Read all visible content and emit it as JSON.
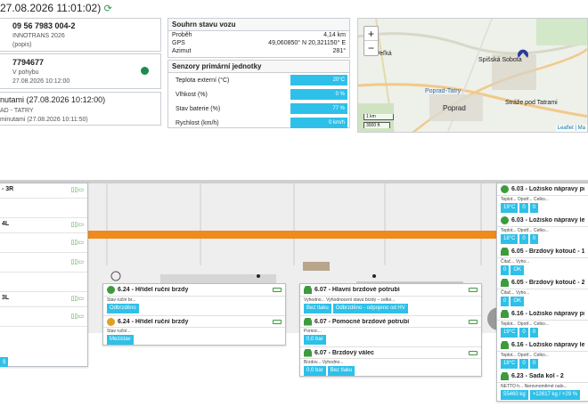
{
  "header": {
    "timestamp": "27.08.2026 11:01:02)"
  },
  "vehicle": {
    "number": "09 56 7983 004-2",
    "owner": "INNOTRANS 2026",
    "description": "(popis)"
  },
  "unit": {
    "id": "7794677",
    "state": "V pohybu",
    "time": "27.08.2026 10:12:00",
    "status_color": "#1f8a4c"
  },
  "trip": {
    "title": "nutami (27.08.2026 10:12:00)",
    "route": "AD - TATRY",
    "minutes": "minutami (27.08.2026 10:11:50)"
  },
  "summary": {
    "title": "Souhrn stavu vozu",
    "rows": [
      {
        "label": "Proběh",
        "value": "4,14 km"
      },
      {
        "label": "GPS",
        "value": "49,060850° N 20,321150° E"
      },
      {
        "label": "Azimut",
        "value": "281°"
      }
    ]
  },
  "sensors": {
    "title": "Senzory primární jednotky",
    "rows": [
      {
        "label": "Teplota externí (°C)",
        "value": "20°C"
      },
      {
        "label": "Vlhkost (%)",
        "value": "0 %"
      },
      {
        "label": "Stav baterie (%)",
        "value": "77 %"
      },
      {
        "label": "Rychlost (km/h)",
        "value": "0 km/h"
      }
    ]
  },
  "map": {
    "zoom_in": "+",
    "zoom_out": "−",
    "scale_km": "1 km",
    "scale_ft": "3000 ft",
    "attribution": "Leaflet | Ma",
    "places": [
      "Veľká",
      "Spišská Sobota",
      "Poprad-Tatry",
      "Poprad",
      "Stráže pod Tatrami"
    ]
  },
  "left_panel": {
    "items": [
      "- 3R",
      "4L",
      "3L"
    ],
    "chip": "g"
  },
  "panels_mid": [
    {
      "title": "6.24 - Hřídel ruční brzdy",
      "sub": "Stav ruční br...",
      "chips": [
        "Odbrzděno"
      ]
    },
    {
      "title": "6.24 - Hřídel ruční brzdy",
      "sub": "Stav ruční...",
      "chips": [
        "Mezistav"
      ]
    }
  ],
  "panels_center": [
    {
      "title": "6.07 - Hlavní brzdové potrubí",
      "sub": "Vyhodno...   Vyhodnocení stavu brzdy – celko...",
      "chips": [
        "Bez tlaku",
        "Odbrzděno - odpojeno od HV"
      ]
    },
    {
      "title": "6.07 - Pomocné brzdové potrubí",
      "sub": "Pomoc...",
      "chips": [
        "0,0 bar"
      ]
    },
    {
      "title": "6.07 - Brzdový válec",
      "sub": "Brzdov...   Vyhodno...",
      "chips": [
        "0,0 bar",
        "Bez tlaku"
      ]
    }
  ],
  "panels_right": [
    {
      "title": "6.03 - Ložisko nápravy pra",
      "sub": "Teplot...  Opotř...  Celko...",
      "chips": [
        "19°C",
        "0",
        "0"
      ]
    },
    {
      "title": "6.03 - Ložisko nápravy levé",
      "sub": "Teplot...  Opotř...  Celko...",
      "chips": [
        "18°C",
        "0",
        "0"
      ]
    },
    {
      "title": "6.05 - Brzdový kotouč - 1L",
      "sub": "Čitač...  Vyho...",
      "chips": [
        "0",
        "OK"
      ]
    },
    {
      "title": "6.05 - Brzdový kotouč - 2L",
      "sub": "Čitač...  Vyho...",
      "chips": [
        "0",
        "OK"
      ]
    },
    {
      "title": "6.16 - Ložisko nápravy pra",
      "sub": "Teplot...  Opotř...  Celko...",
      "chips": [
        "19°C",
        "0",
        "0"
      ]
    },
    {
      "title": "6.16 - Ložisko nápravy levé",
      "sub": "Teplot...  Opotř...  Celko...",
      "chips": [
        "18°C",
        "0",
        "0"
      ]
    },
    {
      "title": "6.23 - Sada kol - 2",
      "sub": "NETTO h...  Nerovnoměrné nalo...",
      "chips": [
        "55460 kg",
        "+12617 kg / +29 %"
      ]
    }
  ],
  "colors": {
    "accent": "#2ec0e8",
    "orange_band": "#f08a1c",
    "green": "#3d9b3d"
  }
}
